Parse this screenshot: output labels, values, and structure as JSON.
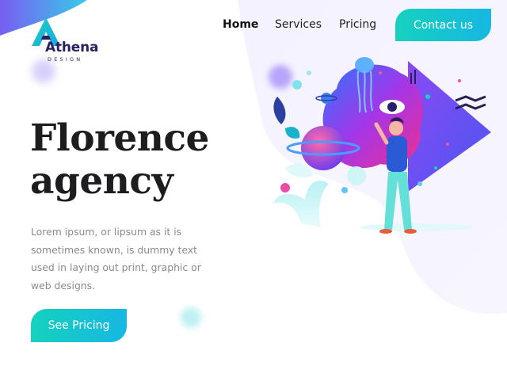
{
  "brand": {
    "name": "Athena",
    "tagline": "DESIGN",
    "logo_icon": "triangle-a-logo-icon"
  },
  "nav": {
    "items": [
      {
        "label": "Home",
        "active": true
      },
      {
        "label": "Services",
        "active": false
      },
      {
        "label": "Pricing",
        "active": false
      }
    ],
    "cta_label": "Contact us"
  },
  "hero": {
    "title_line1": "Florence",
    "title_line2": "agency",
    "description": "Lorem ipsum, or lipsum as it is sometimes known, is dummy text used in laying out print, graphic or web designs.",
    "button_label": "See Pricing",
    "illustration": "abstract-creative-illustration"
  },
  "colors": {
    "accent_start": "#16d1be",
    "accent_end": "#17b7e3",
    "brand_dark": "#2b1f63",
    "illustration_purple": "#6f3cf0",
    "illustration_pink": "#e0309a"
  }
}
